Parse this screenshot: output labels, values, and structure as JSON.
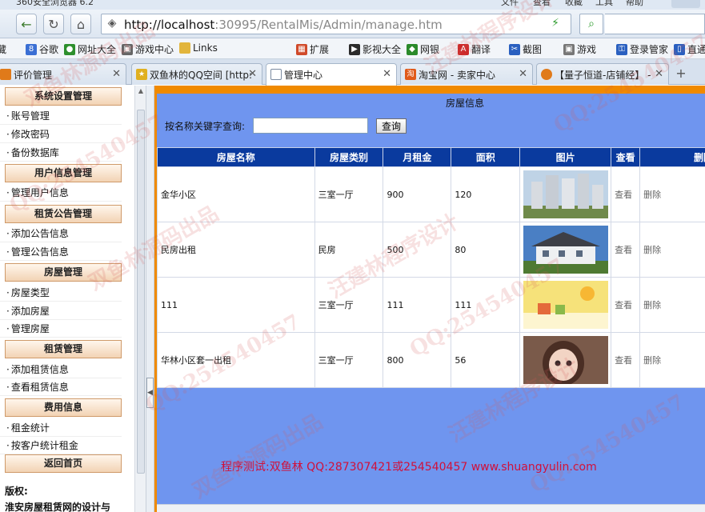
{
  "browser": {
    "title": "360安全浏览器 6.2",
    "menu": [
      "文件",
      "查看",
      "收藏",
      "工具",
      "帮助"
    ],
    "url_host": "http://localhost",
    "url_rest": ":30995/RentalMis/Admin/manage.htm"
  },
  "bookmarks": [
    {
      "label": "藏",
      "icon": "star-icon",
      "color": "#c9a000"
    },
    {
      "label": "谷歌",
      "icon": "google-icon",
      "color": "#3b6fd4"
    },
    {
      "label": "网址大全",
      "icon": "globe-icon",
      "color": "#2d8f2d"
    },
    {
      "label": "游戏中心",
      "icon": "gamepad-icon",
      "color": "#555555"
    },
    {
      "label": "Links",
      "icon": "folder-icon",
      "color": "#e2b53c"
    },
    {
      "label": "扩展",
      "icon": "grid-icon",
      "color": "#d04a2a"
    },
    {
      "label": "影视大全",
      "icon": "play-icon",
      "color": "#2b2b2b"
    },
    {
      "label": "网银",
      "icon": "bank-icon",
      "color": "#2a8a2a"
    },
    {
      "label": "翻译",
      "icon": "translate-icon",
      "color": "#cc2a2a"
    },
    {
      "label": "截图",
      "icon": "scissors-icon",
      "color": "#2a60c0"
    },
    {
      "label": "游戏",
      "icon": "gamepad-icon",
      "color": "#444444"
    },
    {
      "label": "登录管家",
      "icon": "key-icon",
      "color": "#2a60c0"
    },
    {
      "label": "直通",
      "icon": "phone-icon",
      "color": "#2a60c0"
    }
  ],
  "tabs": [
    {
      "label": "评价管理",
      "active": false,
      "icon_color": "#e07a1a"
    },
    {
      "label": "双鱼林的QQ空间 [http:",
      "active": false,
      "icon_color": "#e0b020"
    },
    {
      "label": "管理中心",
      "active": true,
      "icon_color": "#7a8aa0"
    },
    {
      "label": "淘宝网 - 卖家中心",
      "active": false,
      "icon_color": "#e05a1a"
    },
    {
      "label": "【量子恒道-店铺经】 -",
      "active": false,
      "icon_color": "#e07a1a"
    }
  ],
  "sidebar": {
    "sections": [
      {
        "title": "系统设置管理",
        "items": [
          "账号管理",
          "修改密码",
          "备份数据库"
        ]
      },
      {
        "title": "用户信息管理",
        "items": [
          "管理用户信息"
        ]
      },
      {
        "title": "租赁公告管理",
        "items": [
          "添加公告信息",
          "管理公告信息"
        ]
      },
      {
        "title": "房屋管理",
        "items": [
          "房屋类型",
          "添加房屋",
          "管理房屋"
        ]
      },
      {
        "title": "租赁管理",
        "items": [
          "添加租赁信息",
          "查看租赁信息"
        ]
      },
      {
        "title": "费用信息",
        "items": [
          "租金统计",
          "按客户统计租金"
        ]
      },
      {
        "title": "返回首页",
        "items": []
      }
    ],
    "copyright_label": "版权:",
    "copyright_text": "淮安房屋租赁网的设计与"
  },
  "main": {
    "title": "房屋信息",
    "search_label": "按名称关键字查询:",
    "search_value": "",
    "search_button": "查询",
    "columns": [
      "房屋名称",
      "房屋类别",
      "月租金",
      "面积",
      "图片",
      "查看",
      "删除"
    ],
    "rows": [
      {
        "name": "金华小区",
        "type": "三室一厅",
        "rent": "900",
        "area": "120",
        "pic": "building-photo",
        "view": "查看",
        "delete": "删除"
      },
      {
        "name": "民房出租",
        "type": "民房",
        "rent": "500",
        "area": "80",
        "pic": "house-photo",
        "view": "查看",
        "delete": "删除"
      },
      {
        "name": "111",
        "type": "三室一厅",
        "rent": "111",
        "area": "111",
        "pic": "cartoon-photo",
        "view": "查看",
        "delete": "删除"
      },
      {
        "name": "华林小区套一出租",
        "type": "三室一厅",
        "rent": "800",
        "area": "56",
        "pic": "portrait-photo",
        "view": "查看",
        "delete": "删除"
      }
    ],
    "footer": "程序测试:双鱼林 QQ:287307421或254540457 www.shuangyulin.com"
  },
  "watermarks": [
    "QQ:254540457",
    "双鱼林源码出品",
    "汪建林程序设计"
  ]
}
